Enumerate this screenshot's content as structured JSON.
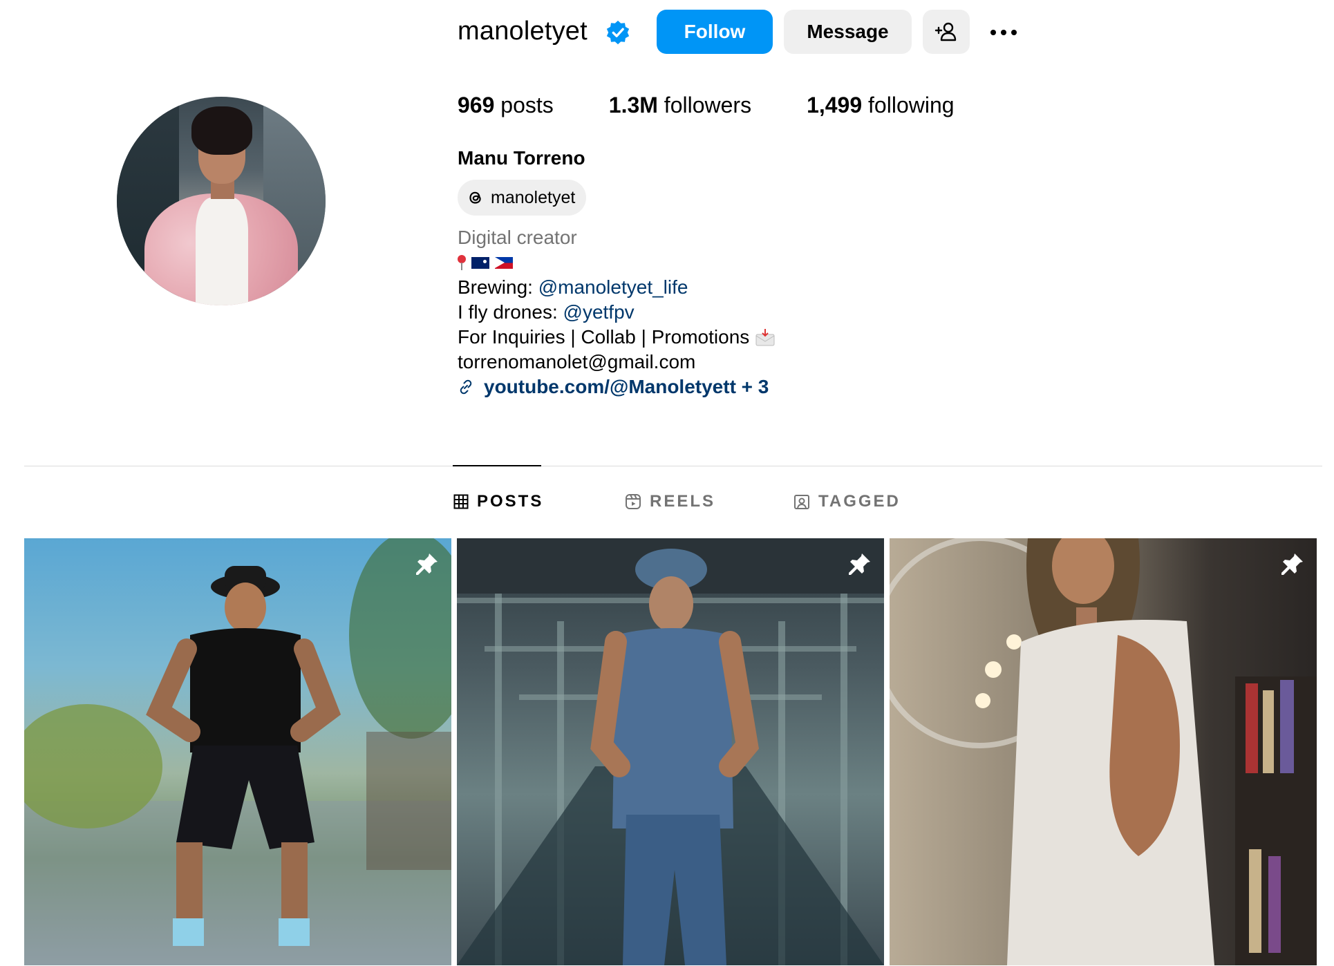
{
  "profile": {
    "username": "manoletyet",
    "follow_label": "Follow",
    "message_label": "Message",
    "full_name": "Manu Torreno",
    "threads_handle": "manoletyet"
  },
  "stats": {
    "posts_count": "969",
    "posts_label": "posts",
    "followers_count": "1.3M",
    "followers_label": "followers",
    "following_count": "1,499",
    "following_label": "following"
  },
  "bio": {
    "category": "Digital creator",
    "brewing_prefix": "Brewing: ",
    "brewing_mention": "@manoletyet_life",
    "drones_prefix": "I fly drones: ",
    "drones_mention": "@yetfpv",
    "inquiries": "For Inquiries | Collab | Promotions",
    "email": "torrenomanolet@gmail.com",
    "link": "youtube.com/@Manoletyett + 3"
  },
  "tabs": [
    {
      "label": "POSTS",
      "active": true
    },
    {
      "label": "REELS",
      "active": false
    },
    {
      "label": "TAGGED",
      "active": false
    }
  ],
  "colors": {
    "accent": "#0095f6",
    "link": "#00376b",
    "muted": "#737373",
    "button_bg": "#efefef"
  },
  "icons": {
    "verified": "verified-badge-icon",
    "add_user": "add-user-icon",
    "more": "more-options-icon",
    "threads": "threads-icon",
    "link": "link-icon",
    "grid": "grid-icon",
    "reels": "reels-icon",
    "tagged": "tagged-icon",
    "pinned": "pin-icon"
  },
  "posts": [
    {
      "pinned": true
    },
    {
      "pinned": true
    },
    {
      "pinned": true
    }
  ]
}
